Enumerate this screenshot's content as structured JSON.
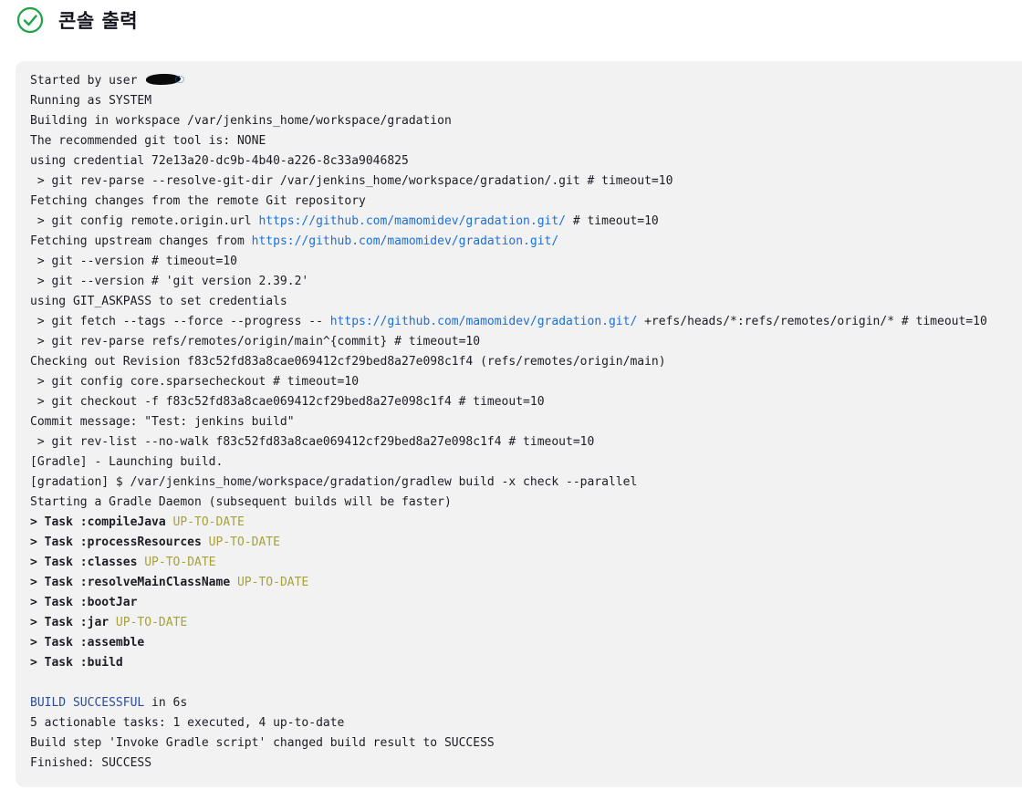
{
  "header": {
    "title": "콘솔 출력",
    "status_icon": "success-check-circle-icon",
    "status_color": "#1ea446"
  },
  "console": {
    "started_by_prefix": "Started by user ",
    "lines_before_tasks": [
      "Running as SYSTEM",
      "Building in workspace /var/jenkins_home/workspace/gradation",
      "The recommended git tool is: NONE",
      "using credential 72e13a20-dc9b-4b40-a226-8c33a9046825",
      " > git rev-parse --resolve-git-dir /var/jenkins_home/workspace/gradation/.git # timeout=10",
      "Fetching changes from the remote Git repository"
    ],
    "git_config_url": {
      "prefix": " > git config remote.origin.url ",
      "link": "https://github.com/mamomidev/gradation.git/",
      "suffix": " # timeout=10"
    },
    "fetching_upstream": {
      "prefix": "Fetching upstream changes from ",
      "link": "https://github.com/mamomidev/gradation.git/"
    },
    "lines_mid": [
      " > git --version # timeout=10",
      " > git --version # 'git version 2.39.2'",
      "using GIT_ASKPASS to set credentials"
    ],
    "git_fetch": {
      "prefix": " > git fetch --tags --force --progress -- ",
      "link": "https://github.com/mamomidev/gradation.git/",
      "suffix": " +refs/heads/*:refs/remotes/origin/* # timeout=10"
    },
    "lines_after_fetch": [
      " > git rev-parse refs/remotes/origin/main^{commit} # timeout=10",
      "Checking out Revision f83c52fd83a8cae069412cf29bed8a27e098c1f4 (refs/remotes/origin/main)",
      " > git config core.sparsecheckout # timeout=10",
      " > git checkout -f f83c52fd83a8cae069412cf29bed8a27e098c1f4 # timeout=10",
      "Commit message: \"Test: jenkins build\"",
      " > git rev-list --no-walk f83c52fd83a8cae069412cf29bed8a27e098c1f4 # timeout=10",
      "[Gradle] - Launching build.",
      "[gradation] $ /var/jenkins_home/workspace/gradation/gradlew build -x check --parallel",
      "Starting a Gradle Daemon (subsequent builds will be faster)"
    ],
    "tasks": [
      {
        "label": "> Task :compileJava",
        "status": " UP-TO-DATE"
      },
      {
        "label": "> Task :processResources",
        "status": " UP-TO-DATE"
      },
      {
        "label": "> Task :classes",
        "status": " UP-TO-DATE"
      },
      {
        "label": "> Task :resolveMainClassName",
        "status": " UP-TO-DATE"
      },
      {
        "label": "> Task :bootJar",
        "status": ""
      },
      {
        "label": "> Task :jar",
        "status": " UP-TO-DATE"
      },
      {
        "label": "> Task :assemble",
        "status": ""
      },
      {
        "label": "> Task :build",
        "status": ""
      }
    ],
    "build_result": {
      "label": "BUILD SUCCESSFUL",
      "suffix": " in 6s"
    },
    "lines_end": [
      "5 actionable tasks: 1 executed, 4 up-to-date",
      "Build step 'Invoke Gradle script' changed build result to SUCCESS",
      "Finished: SUCCESS"
    ],
    "colors": {
      "link": "#1b6fd6",
      "up_to_date": "#a8a13a",
      "build_successful": "#2b4d9a",
      "background": "#f2f2f3"
    }
  }
}
